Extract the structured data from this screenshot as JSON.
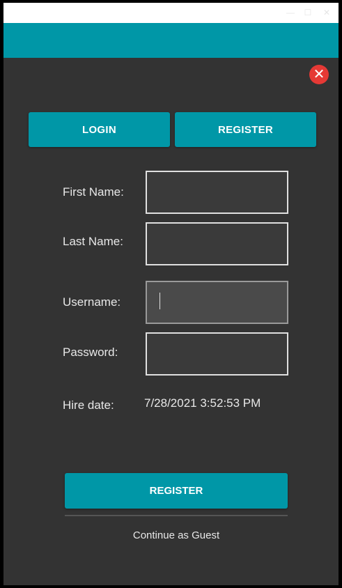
{
  "titlebar": {
    "minimize_glyph": "—",
    "maximize_glyph": "☐",
    "close_glyph": "✕"
  },
  "close_glyph": "✕",
  "tabs": {
    "login_label": "LOGIN",
    "register_label": "REGISTER"
  },
  "form": {
    "first_name_label": "First Name:",
    "last_name_label": "Last Name:",
    "username_label": "Username:",
    "password_label": "Password:",
    "hire_date_label": "Hire date:",
    "hire_date_value": "7/28/2021 3:52:53 PM",
    "first_name_value": "",
    "last_name_value": "",
    "username_value": "",
    "password_value": ""
  },
  "actions": {
    "register_label": "REGISTER",
    "guest_label": "Continue as Guest"
  },
  "colors": {
    "accent": "#0097a7",
    "background": "#333333",
    "close": "#e53935"
  }
}
